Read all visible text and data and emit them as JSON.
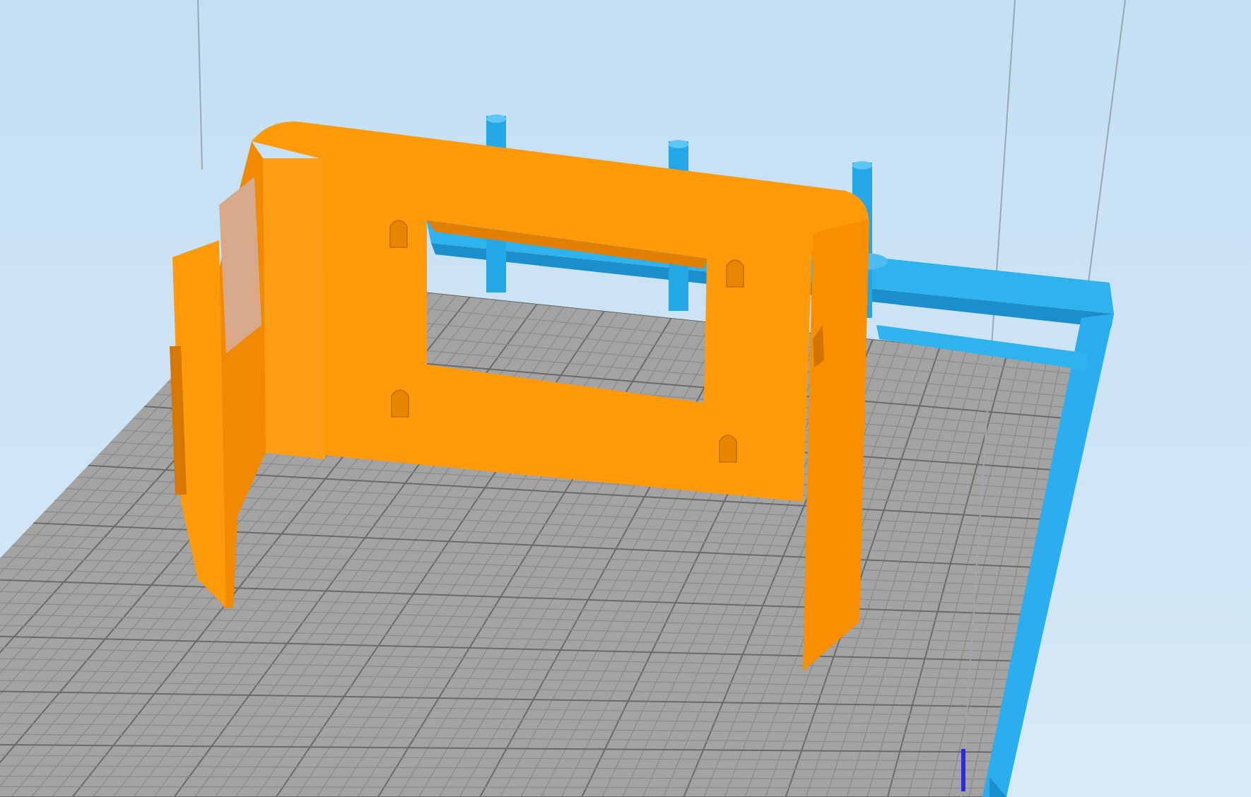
{
  "scene": {
    "objects": [
      {
        "kind": "plate"
      },
      {
        "kind": "frame"
      },
      {
        "kind": "part"
      }
    ]
  }
}
